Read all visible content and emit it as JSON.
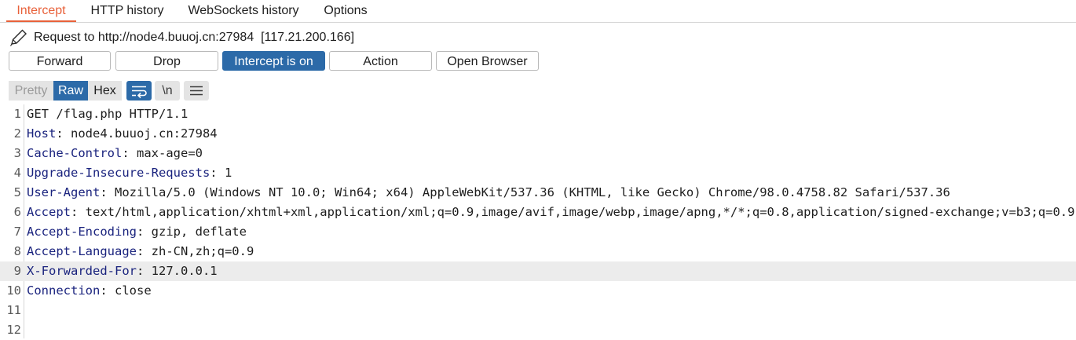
{
  "tabs": [
    {
      "label": "Intercept",
      "active": true
    },
    {
      "label": "HTTP history",
      "active": false
    },
    {
      "label": "WebSockets history",
      "active": false
    },
    {
      "label": "Options",
      "active": false
    }
  ],
  "request_info": {
    "icon": "pencil-icon",
    "text": "Request to http://node4.buuoj.cn:27984  [117.21.200.166]"
  },
  "buttons": {
    "forward": "Forward",
    "drop": "Drop",
    "intercept": "Intercept is on",
    "action": "Action",
    "open_browser": "Open Browser"
  },
  "view_modes": {
    "pretty": "Pretty",
    "raw": "Raw",
    "hex": "Hex",
    "selected": "Raw"
  },
  "view_tools": {
    "wrap_icon": "wrap-lines-icon",
    "newline_label": "\\n",
    "menu_icon": "hamburger-menu-icon"
  },
  "colors": {
    "accent_tab": "#e8613a",
    "primary_blue": "#2c6aa8",
    "header_name": "#1a237e"
  },
  "editor": {
    "highlighted_line": 9,
    "lines": [
      {
        "num": "1",
        "name": "",
        "sep": "",
        "value": "GET /flag.php HTTP/1.1"
      },
      {
        "num": "2",
        "name": "Host",
        "sep": ": ",
        "value": "node4.buuoj.cn:27984"
      },
      {
        "num": "3",
        "name": "Cache-Control",
        "sep": ": ",
        "value": "max-age=0"
      },
      {
        "num": "4",
        "name": "Upgrade-Insecure-Requests",
        "sep": ": ",
        "value": "1"
      },
      {
        "num": "5",
        "name": "User-Agent",
        "sep": ": ",
        "value": "Mozilla/5.0 (Windows NT 10.0; Win64; x64) AppleWebKit/537.36 (KHTML, like Gecko) Chrome/98.0.4758.82 Safari/537.36"
      },
      {
        "num": "6",
        "name": "Accept",
        "sep": ": ",
        "value": "text/html,application/xhtml+xml,application/xml;q=0.9,image/avif,image/webp,image/apng,*/*;q=0.8,application/signed-exchange;v=b3;q=0.9"
      },
      {
        "num": "7",
        "name": "Accept-Encoding",
        "sep": ": ",
        "value": "gzip, deflate"
      },
      {
        "num": "8",
        "name": "Accept-Language",
        "sep": ": ",
        "value": "zh-CN,zh;q=0.9"
      },
      {
        "num": "9",
        "name": "X-Forwarded-For",
        "sep": ": ",
        "value": "127.0.0.1"
      },
      {
        "num": "10",
        "name": "Connection",
        "sep": ": ",
        "value": "close"
      },
      {
        "num": "11",
        "name": "",
        "sep": "",
        "value": ""
      },
      {
        "num": "12",
        "name": "",
        "sep": "",
        "value": ""
      }
    ]
  }
}
